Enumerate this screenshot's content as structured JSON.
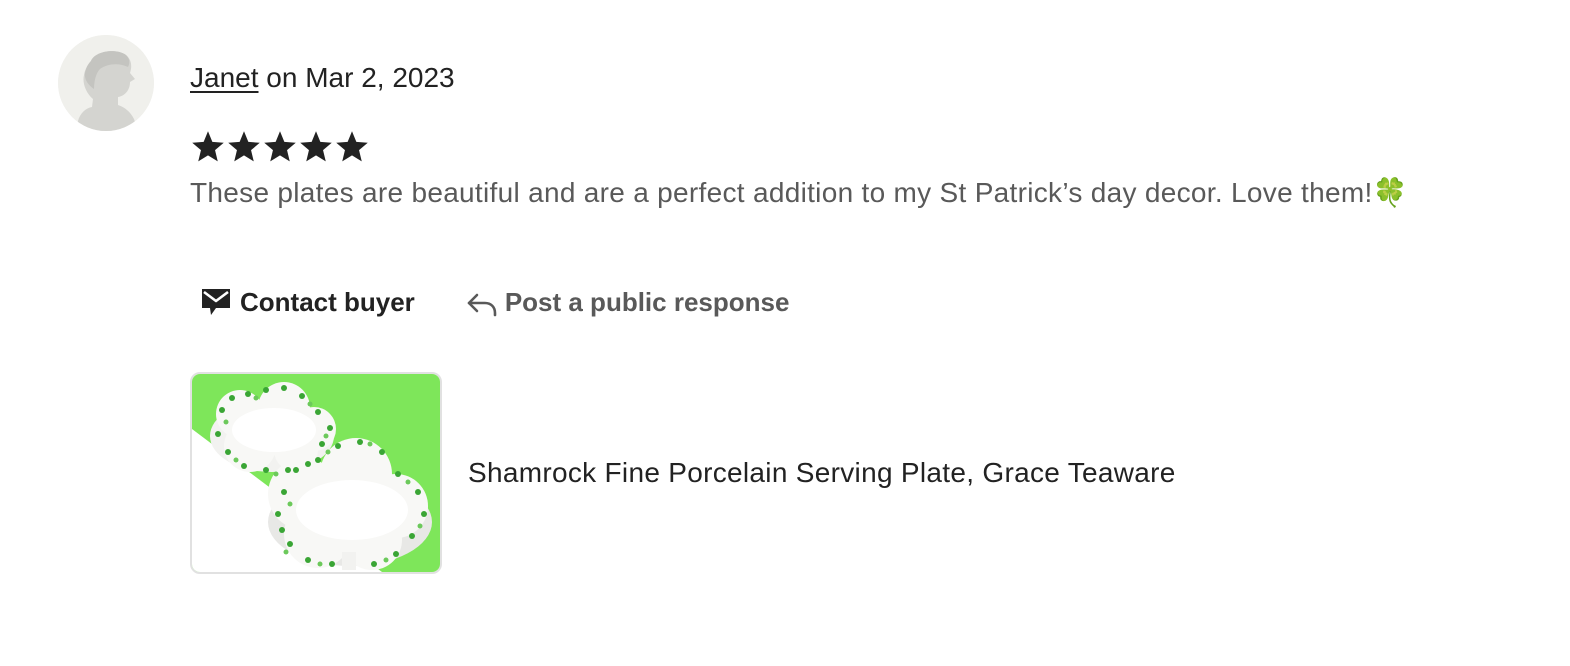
{
  "review": {
    "reviewer_name": "Janet",
    "date_text": "on Mar 2, 2023",
    "rating": 5,
    "rating_max": 5,
    "text": "These plates are beautiful and are a perfect addition to my St Patrick’s day decor. Love them!",
    "text_emoji": "🍀"
  },
  "actions": {
    "contact_label": "Contact buyer",
    "contact_icon": "envelope-icon",
    "respond_label": "Post a public response",
    "respond_icon": "reply-arrow-icon"
  },
  "product": {
    "title": "Shamrock Fine Porcelain Serving Plate, Grace Teaware"
  },
  "colors": {
    "text_primary": "#222222",
    "text_secondary": "#595959",
    "star": "#222222",
    "avatar_bg": "#f0f0ec",
    "thumb_green": "#7ee65a"
  }
}
